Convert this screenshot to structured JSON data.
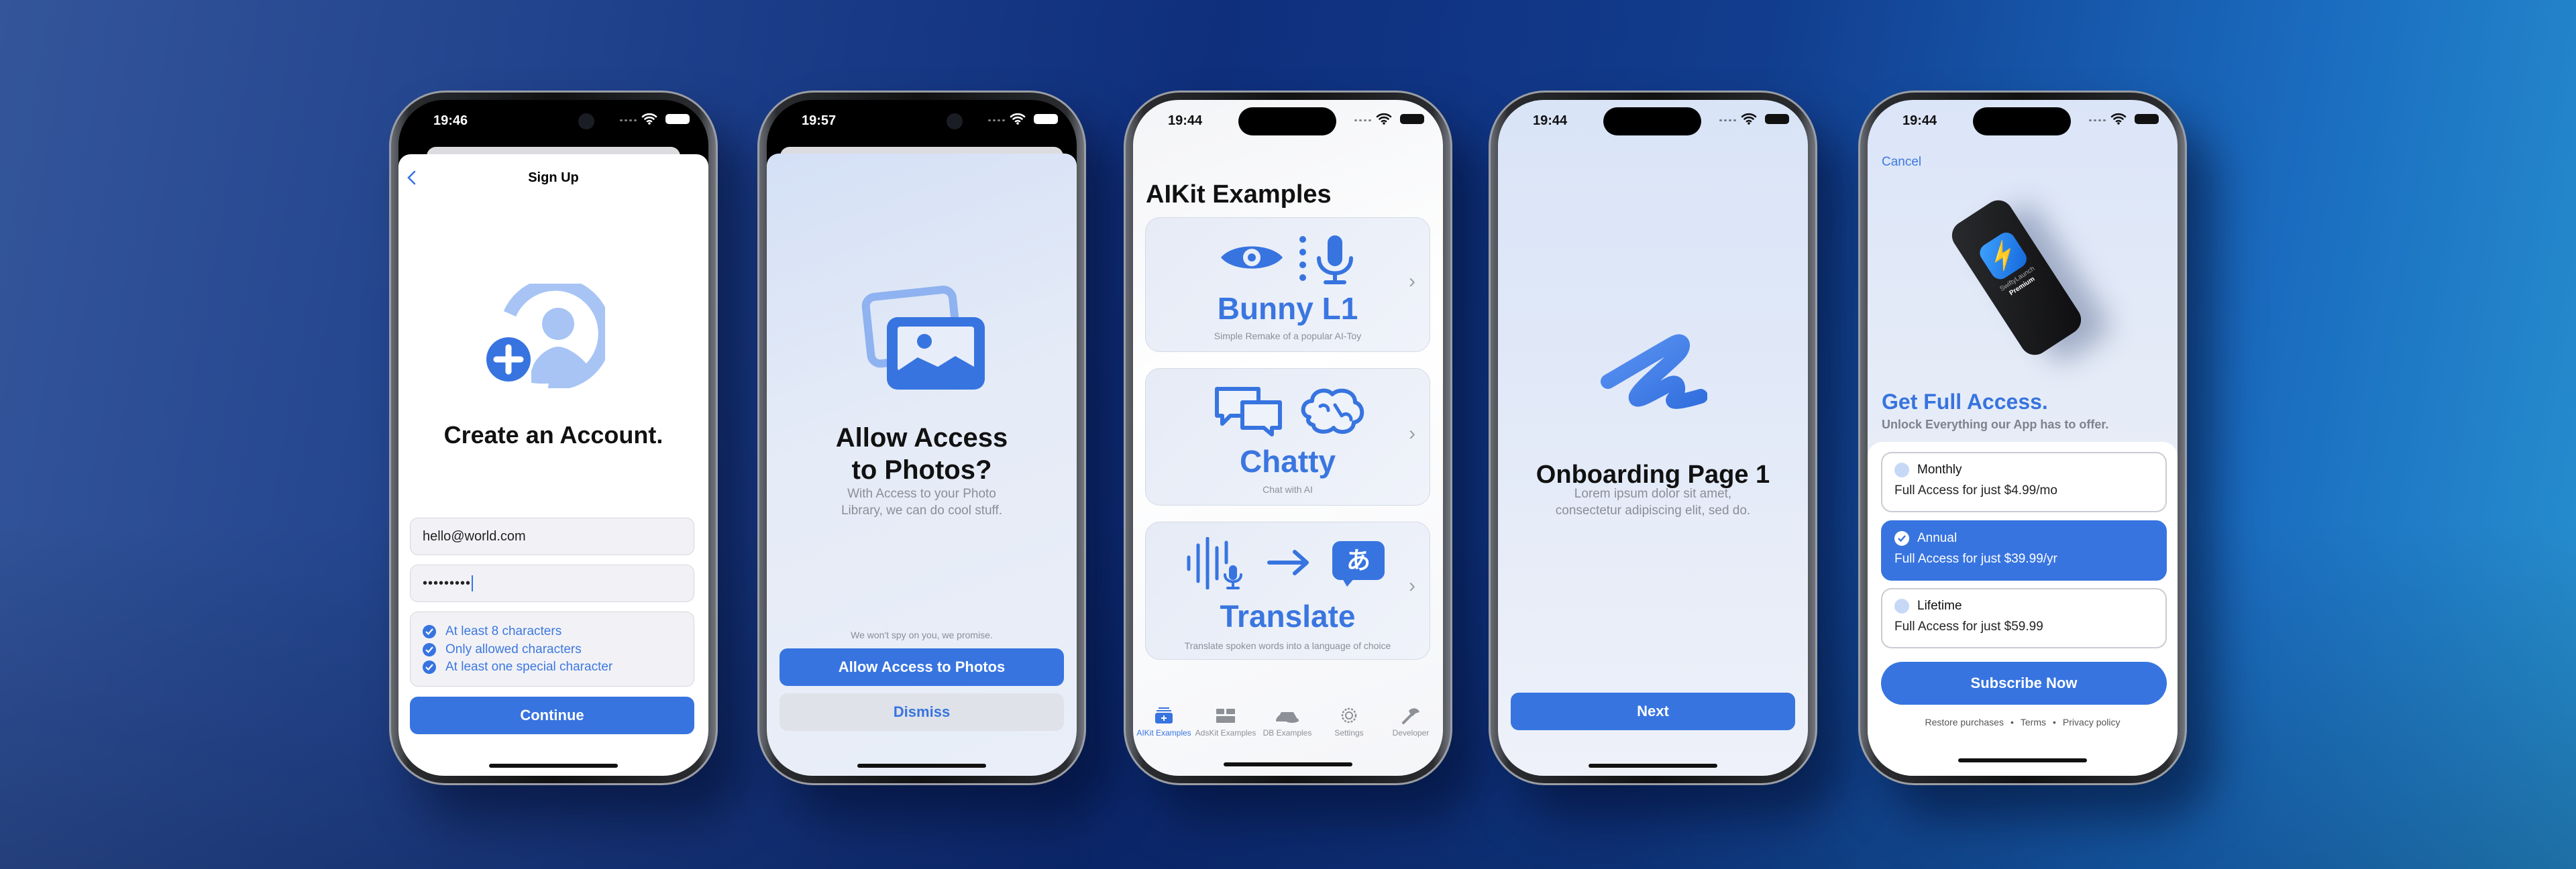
{
  "colors": {
    "accent": "#3774e0",
    "accent_light": "#a7c4f5",
    "background": "#0f2f7c"
  },
  "signup": {
    "status_time": "19:46",
    "nav_title": "Sign Up",
    "back_icon": "chevron-left-icon",
    "hero_icon": "person-add-icon",
    "title": "Create an Account.",
    "email_value": "hello@world.com",
    "password_value": "•••••••••",
    "requirements": [
      "At least 8 characters",
      "Only allowed characters",
      "At least one special character"
    ],
    "continue_label": "Continue"
  },
  "photos": {
    "status_time": "19:57",
    "hero_icon": "photos-icon",
    "title_line1": "Allow Access",
    "title_line2": "to Photos?",
    "subtitle_line1": "With Access to your Photo",
    "subtitle_line2": "Library, we can do cool stuff.",
    "note": "We won't spy on you, we promise.",
    "allow_label": "Allow Access to Photos",
    "dismiss_label": "Dismiss"
  },
  "aikit": {
    "status_time": "19:44",
    "title": "AIKit Examples",
    "cards": [
      {
        "title": "Bunny L1",
        "subtitle": "Simple Remake of a popular AI-Toy",
        "icons": [
          "eye-icon",
          "microphone-icon"
        ]
      },
      {
        "title": "Chatty",
        "subtitle": "Chat with AI",
        "icons": [
          "chat-bubbles-icon",
          "brain-icon"
        ]
      },
      {
        "title": "Translate",
        "subtitle": "Translate spoken words into a language of choice",
        "icons": [
          "waveform-mic-icon",
          "arrow-right-icon",
          "translate-bubble-icon"
        ],
        "glyph": "あ"
      }
    ],
    "tabs": [
      {
        "label": "AIKit Examples",
        "icon": "sparkles-stack-icon",
        "active": true
      },
      {
        "label": "AdsKit Examples",
        "icon": "blocks-icon",
        "active": false
      },
      {
        "label": "DB Examples",
        "icon": "database-icon",
        "active": false
      },
      {
        "label": "Settings",
        "icon": "gear-icon",
        "active": false
      },
      {
        "label": "Developer",
        "icon": "hammer-icon",
        "active": false
      }
    ]
  },
  "onboarding": {
    "status_time": "19:44",
    "hero_icon": "scribble-icon",
    "title": "Onboarding Page 1",
    "subtitle_line1": "Lorem ipsum dolor sit amet,",
    "subtitle_line2": "consectetur adipiscing elit, sed do.",
    "next_label": "Next"
  },
  "paywall": {
    "status_time": "19:44",
    "cancel_label": "Cancel",
    "product_name": "SwiftyLaunch",
    "product_tier": "Premium",
    "title": "Get Full Access.",
    "subtitle": "Unlock Everything our App has to offer.",
    "plans": [
      {
        "name": "Monthly",
        "price": "Full Access for just $4.99/mo",
        "selected": false
      },
      {
        "name": "Annual",
        "price": "Full Access for just $39.99/yr",
        "selected": true
      },
      {
        "name": "Lifetime",
        "price": "Full Access for just $59.99",
        "selected": false
      }
    ],
    "subscribe_label": "Subscribe Now",
    "footer_links": [
      "Restore purchases",
      "Terms",
      "Privacy policy"
    ],
    "footer_separator": "•"
  }
}
